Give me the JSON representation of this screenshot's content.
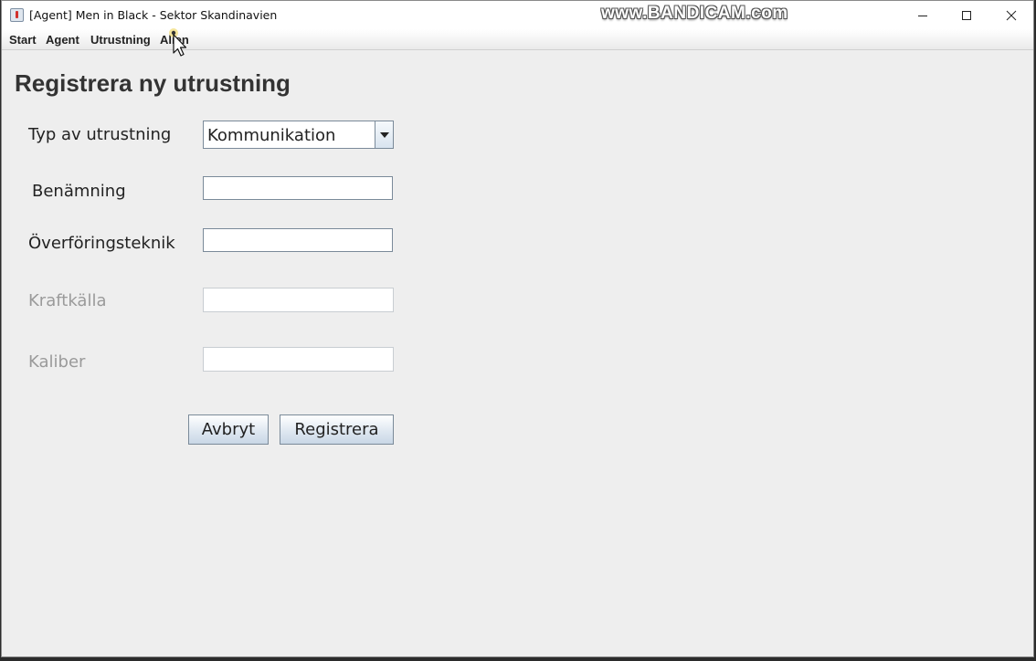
{
  "window": {
    "title": "[Agent] Men in Black - Sektor Skandinavien",
    "watermark": "www.BANDICAM.com"
  },
  "menu": {
    "items": [
      "Start",
      "Agent",
      "Utrustning",
      "Alien"
    ]
  },
  "page": {
    "title": "Registrera ny utrustning"
  },
  "form": {
    "type_label": "Typ av utrustning",
    "type_value": "Kommunikation",
    "name_label": "Benämning",
    "name_value": "",
    "transfer_label": "Överföringsteknik",
    "transfer_value": "",
    "power_label": "Kraftkälla",
    "power_value": "",
    "caliber_label": "Kaliber",
    "caliber_value": ""
  },
  "buttons": {
    "cancel": "Avbryt",
    "register": "Registrera"
  }
}
